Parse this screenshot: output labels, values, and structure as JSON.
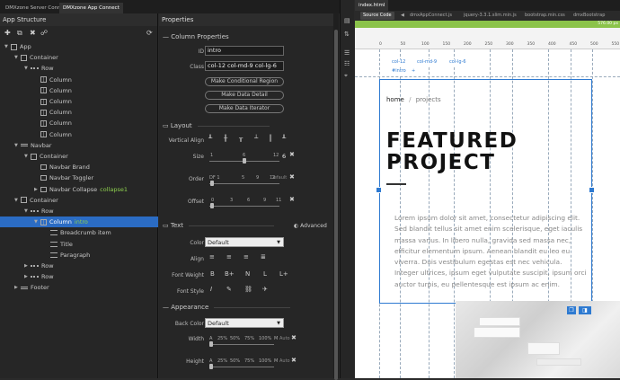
{
  "tabs": {
    "server": "DMXzone Server Connect",
    "app": "DMXzone App Connect"
  },
  "app_structure": {
    "title": "App Structure",
    "tree": [
      {
        "label": "App",
        "icon": "app-icon",
        "depth": 0,
        "arrow": "down"
      },
      {
        "label": "Container",
        "icon": "container-icon",
        "depth": 1,
        "arrow": "down"
      },
      {
        "label": "Row",
        "icon": "row-icon",
        "depth": 2,
        "arrow": "down"
      },
      {
        "label": "Column",
        "icon": "column-icon",
        "depth": 3,
        "arrow": ""
      },
      {
        "label": "Column",
        "icon": "column-icon",
        "depth": 3,
        "arrow": ""
      },
      {
        "label": "Column",
        "icon": "column-icon",
        "depth": 3,
        "arrow": ""
      },
      {
        "label": "Column",
        "icon": "column-icon",
        "depth": 3,
        "arrow": ""
      },
      {
        "label": "Column",
        "icon": "column-icon",
        "depth": 3,
        "arrow": ""
      },
      {
        "label": "Column",
        "icon": "column-icon",
        "depth": 3,
        "arrow": ""
      },
      {
        "label": "Navbar",
        "icon": "navbar-icon",
        "depth": 1,
        "arrow": "down"
      },
      {
        "label": "Container",
        "icon": "container-icon",
        "depth": 2,
        "arrow": "down"
      },
      {
        "label": "Navbar Brand",
        "icon": "brand-icon",
        "depth": 3,
        "arrow": ""
      },
      {
        "label": "Navbar Toggler",
        "icon": "toggler-icon",
        "depth": 3,
        "arrow": ""
      },
      {
        "label": "Navbar Collapse",
        "icon": "collapse-icon",
        "depth": 3,
        "arrow": "right",
        "id": "collapse1"
      },
      {
        "label": "Container",
        "icon": "container-icon",
        "depth": 1,
        "arrow": "down"
      },
      {
        "label": "Row",
        "icon": "row-icon",
        "depth": 2,
        "arrow": "down"
      },
      {
        "label": "Column",
        "icon": "column-icon",
        "depth": 3,
        "arrow": "down",
        "id": "intro",
        "selected": true
      },
      {
        "label": "Breadcrumb item",
        "icon": "breadcrumb-icon",
        "depth": 4,
        "arrow": ""
      },
      {
        "label": "Title",
        "icon": "title-icon",
        "depth": 4,
        "arrow": ""
      },
      {
        "label": "Paragraph",
        "icon": "paragraph-icon",
        "depth": 4,
        "arrow": ""
      },
      {
        "label": "Row",
        "icon": "row-icon",
        "depth": 2,
        "arrow": "right"
      },
      {
        "label": "Row",
        "icon": "row-icon",
        "depth": 2,
        "arrow": "right"
      },
      {
        "label": "Footer",
        "icon": "footer-icon",
        "depth": 1,
        "arrow": "right"
      }
    ]
  },
  "properties": {
    "title": "Properties",
    "column_properties": "Column Properties",
    "id_label": "ID",
    "id_value": "intro",
    "class_label": "Class",
    "class_value": "col-12 col-md-9 col-lg-6",
    "btn_conditional": "Make Conditional Region",
    "btn_detail": "Make Data Detail",
    "btn_iterator": "Make Data Iterator",
    "layout": "Layout",
    "vertical_align": "Vertical Align",
    "size": "Size",
    "size_scale": [
      "1",
      "6",
      "12"
    ],
    "size_value": "6",
    "order": "Order",
    "order_scale": [
      "DF 1",
      "5",
      "9",
      "12"
    ],
    "order_value": "Default",
    "offset": "Offset",
    "offset_scale": [
      "0",
      "3",
      "6",
      "9",
      "11"
    ],
    "text": "Text",
    "advanced": "Advanced",
    "color": "Color",
    "color_value": "Default",
    "align": "Align",
    "font_weight": "Font Weight",
    "fw_options": [
      "B",
      "B+",
      "N",
      "L",
      "L+"
    ],
    "font_style": "Font Style",
    "appearance": "Appearance",
    "back_color": "Back Color",
    "back_color_value": "Default",
    "width": "Width",
    "height": "Height",
    "wh_scale": [
      "A",
      "25%",
      "50%",
      "75%",
      "100%",
      "M",
      "Auto"
    ]
  },
  "document": {
    "tab": "index.html",
    "file_tabs": [
      "Source Code",
      "dmxAppConnect.js",
      "jquery-3.3.1.slim.min.js",
      "bootstrap.min.css",
      "dmxBootstrap"
    ],
    "width_readout": "576.00 px",
    "ruler_ticks": [
      "0",
      "50",
      "100",
      "150",
      "200",
      "250",
      "300",
      "350",
      "400",
      "450",
      "500",
      "550"
    ],
    "selection": {
      "tag": "div",
      "classes": [
        "col-12",
        "col-md-9",
        "col-lg-6"
      ],
      "id": "#intro"
    },
    "breadcrumb": [
      "home",
      "projects"
    ],
    "heading_line1": "FEATURED",
    "heading_line2": "PROJECT",
    "paragraph": "Lorem ipsum dolor sit amet, consectetur adipiscing elit. Sed blandit tellus sit amet enim scelerisque, eget iaculis massa varius. In libero nulla, gravida sed massa nec, efficitur elementum ipsum. Aenean blandit eu leo eu viverra. Duis vestibulum egestas est nec vehicula. Integer ultrices, ipsum eget vulputate suscipit, ipsum orci auctor turpis, eu pellentesque est ipsum ac enim."
  }
}
